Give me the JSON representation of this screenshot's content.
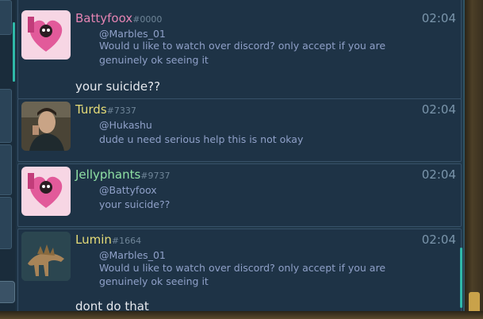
{
  "messages": [
    {
      "username": "Battyfoox",
      "tag": "#0000",
      "time": "02:04",
      "name_color": "#e584b3",
      "avatar": "battyfoox-avatar",
      "reply_to": "@Marbles_01",
      "reply_text_1": "Would u like to watch over discord? only accept if you are",
      "reply_text_2": "genuinely ok seeing it",
      "text": "your suicide??"
    },
    {
      "username": "Turds",
      "tag": "#7337",
      "time": "02:04",
      "name_color": "#e6dc78",
      "avatar": "turds-avatar",
      "reply_to": "@Hukashu",
      "reply_text_1": "dude u need serious help this is not okay"
    },
    {
      "username": "Jellyphants",
      "tag": "#9737",
      "time": "02:04",
      "name_color": "#8fe0a4",
      "avatar": "jellyphants-avatar",
      "reply_to": "@Battyfoox",
      "reply_text_1": "your suicide??"
    },
    {
      "username": "Lumin",
      "tag": "#1664",
      "time": "02:04",
      "name_color": "#e6dc78",
      "avatar": "lumin-avatar",
      "reply_to": "@Marbles_01",
      "reply_text_1": "Would u like to watch over discord? only accept if you are",
      "reply_text_2": "genuinely ok seeing it",
      "text": "dont do that"
    }
  ]
}
